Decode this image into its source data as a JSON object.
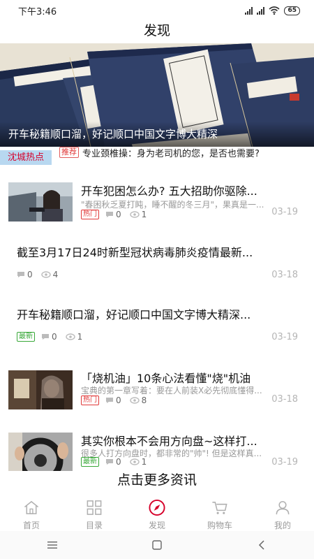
{
  "status": {
    "time": "下午3:46",
    "battery": "65"
  },
  "page": {
    "title": "发现"
  },
  "banner": {
    "caption": "开车秘籍顺口溜，好记顺口中国文字博大精深"
  },
  "section": {
    "tag": "沈城热点"
  },
  "promo": {
    "tag": "推荐",
    "text": "专业颈椎操：身为老司机的您，是否也需要?"
  },
  "news": [
    {
      "title": "开车犯困怎么办? 五大招助你驱除...",
      "summary": "\"春困秋乏夏打盹，睡不醒的冬三月\"，果真是一...",
      "badge": "热门",
      "comments": "0",
      "views": "1",
      "date": "03-19"
    },
    {
      "title": "截至3月17日24时新型冠状病毒肺炎疫情最新...",
      "comments": "0",
      "views": "4",
      "date": "03-18"
    },
    {
      "title": "开车秘籍顺口溜，好记顺口中国文字博大精深...",
      "badge": "最新",
      "comments": "0",
      "views": "1",
      "date": "03-19"
    },
    {
      "title": "「烧机油」10条心法看懂\"烧\"机油",
      "summary": "宝典的第一章写着：要在人前装X必先彻底懂得...",
      "badge": "热门",
      "comments": "0",
      "views": "8",
      "date": "03-18"
    },
    {
      "title": "其实你根本不会用方向盘~这样打...",
      "summary": "很多人打方向盘时，都非常的\"帅\"! 但是这样真...",
      "badge": "最新",
      "comments": "0",
      "views": "1",
      "date": "03-19"
    }
  ],
  "more": {
    "label": "点击更多资讯"
  },
  "tabs": [
    {
      "label": "首页",
      "icon": "home-icon"
    },
    {
      "label": "目录",
      "icon": "grid-icon"
    },
    {
      "label": "发现",
      "icon": "compass-icon",
      "active": true
    },
    {
      "label": "购物车",
      "icon": "cart-icon"
    },
    {
      "label": "我的",
      "icon": "user-icon"
    }
  ],
  "colors": {
    "accent": "#d6002a",
    "hot": "#e03838",
    "new": "#38a838",
    "section_bg": "#b8d8f0",
    "muted": "#b5b5b5"
  }
}
